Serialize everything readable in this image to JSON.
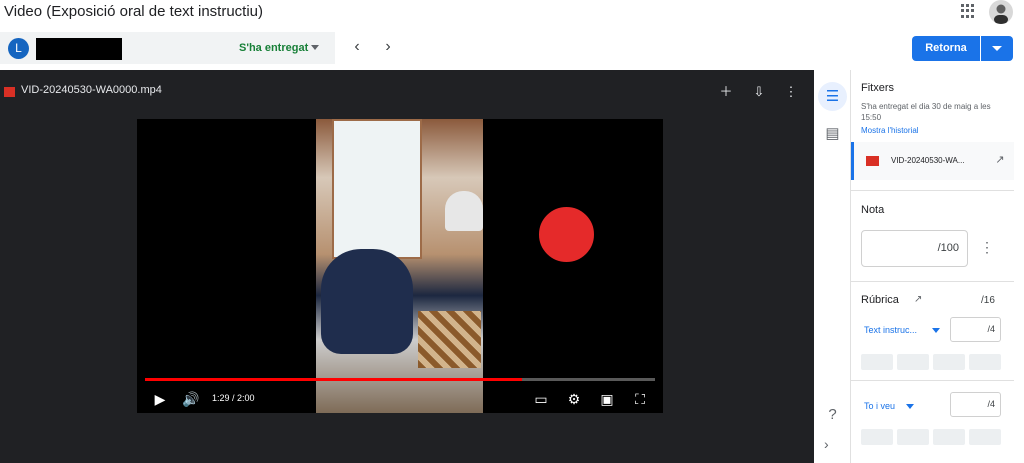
{
  "app": {
    "title": "Video (Exposició oral de text instructiu)"
  },
  "studentbar": {
    "avatar_letter": "L",
    "status": "S'ha entregat"
  },
  "toolbar": {
    "return_label": "Retorna",
    "prev_icon": "chevron-left-icon",
    "next_icon": "chevron-right-icon"
  },
  "viewer": {
    "filename": "VID-20240530-WA0000.mp4",
    "time": "1:29 / 2:00",
    "progress_fraction": 0.74
  },
  "panel": {
    "files_title": "Fitxers",
    "submitted_text": "S'ha entregat el dia 30 de maig a les 15:50",
    "history_link": "Mostra l'historial",
    "attachment_name": "VID-20240530-WA...",
    "grade_title": "Nota",
    "grade_denominator": "/100",
    "rubric_title": "Rúbrica",
    "rubric_total": "/16",
    "criteria": [
      {
        "label": "Text instruc...",
        "denominator": "/4"
      },
      {
        "label": "To i veu",
        "denominator": "/4"
      }
    ]
  },
  "colors": {
    "accent": "#1a73e8",
    "success": "#188038",
    "video_progress": "#ff0000"
  }
}
